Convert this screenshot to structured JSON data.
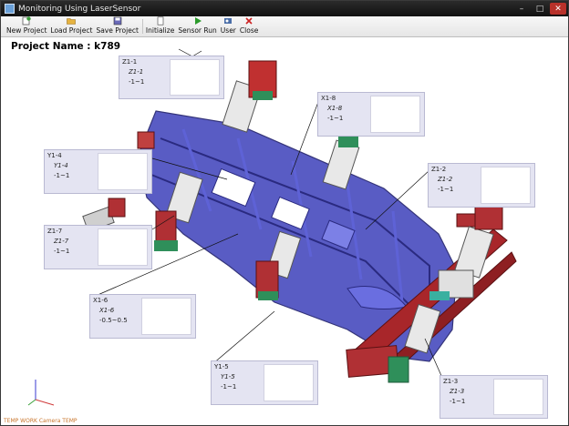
{
  "window": {
    "title": "Monitoring Using LaserSensor",
    "controls": {
      "minimize": "–",
      "maximize": "□",
      "close": "✕"
    }
  },
  "toolbar": {
    "buttons": [
      {
        "label": "New Project",
        "icon": "new-project-icon",
        "color": "#3b9a3b"
      },
      {
        "label": "Load Project",
        "icon": "folder-icon",
        "color": "#d79a24"
      },
      {
        "label": "Save Project",
        "icon": "save-icon",
        "color": "#5a5aa8"
      },
      {
        "label": "Initialize",
        "icon": "document-icon",
        "color": "#777777"
      },
      {
        "label": "Sensor Run",
        "icon": "play-icon",
        "color": "#2a9a2a"
      },
      {
        "label": "User",
        "icon": "user-icon",
        "color": "#4a6ea8"
      },
      {
        "label": "Close",
        "icon": "close-icon",
        "color": "#cc2222"
      }
    ]
  },
  "project": {
    "name": "Project Name : k789"
  },
  "sensors": [
    {
      "id": "Z1-1",
      "sub": "Z1-1",
      "value": "-1~1"
    },
    {
      "id": "X1-8",
      "sub": "X1-8",
      "value": "-1~1"
    },
    {
      "id": "Y1-4",
      "sub": "Y1-4",
      "value": "-1~1"
    },
    {
      "id": "Z1-2",
      "sub": "Z1-2",
      "value": "-1~1"
    },
    {
      "id": "Z1-7",
      "sub": "Z1-7",
      "value": "-1~1"
    },
    {
      "id": "X1-6",
      "sub": "X1-6",
      "value": "-0.5~0.5"
    },
    {
      "id": "Y1-5",
      "sub": "Y1-5",
      "value": "-1~1"
    },
    {
      "id": "Z1-3",
      "sub": "Z1-3",
      "value": "-1~1"
    }
  ],
  "footer": {
    "text": "TEMP WORK Camera TEMP"
  },
  "colors": {
    "model_blue": "#4c4fc0",
    "fixture_red": "#a8262a",
    "fixture_green": "#2f8f5a"
  }
}
